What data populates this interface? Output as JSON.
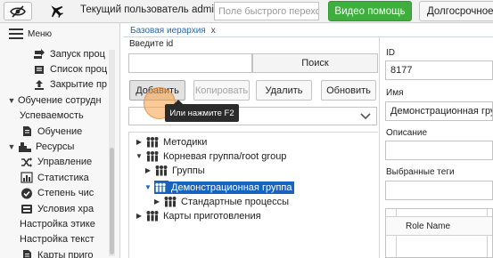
{
  "topbar": {
    "current_user": "Текущий пользователь admin",
    "quick_search_placeholder": "Поле быстрого перехо,",
    "video_help": "Видео помощь",
    "long_button": "Долгосрочное"
  },
  "sidebar": {
    "menu_label": "Меню",
    "items": [
      {
        "label": "Запуск проц",
        "icon": "run-process-icon",
        "indent": 2
      },
      {
        "label": "Список проц",
        "icon": "process-list-icon",
        "indent": 2
      },
      {
        "label": "Закрытие пр",
        "icon": "closing-icon",
        "indent": 2
      },
      {
        "label": "Обучение сотрудн",
        "icon": "",
        "indent": 0,
        "arrow": "▼"
      },
      {
        "label": "Успеваемость",
        "icon": "",
        "indent": 1
      },
      {
        "label": "Обучение",
        "icon": "document-icon",
        "indent": 1
      },
      {
        "label": "Ресурсы",
        "icon": "resources-icon",
        "indent": 0,
        "arrow": "▼"
      },
      {
        "label": "Управление",
        "icon": "shuffle-icon",
        "indent": 1
      },
      {
        "label": "Статистика",
        "icon": "bar-chart-icon",
        "indent": 1
      },
      {
        "label": "Степень чис",
        "icon": "check-circle-icon",
        "indent": 1
      },
      {
        "label": "Условия хра",
        "icon": "storage-icon",
        "indent": 1
      },
      {
        "label": "Настройка этике",
        "icon": "",
        "indent": 1
      },
      {
        "label": "Настройка текст",
        "icon": "",
        "indent": 1
      },
      {
        "label": "Карты приго",
        "icon": "document-icon",
        "indent": 1
      }
    ]
  },
  "tab": {
    "label": "Базовая иерархия",
    "close": "x"
  },
  "form": {
    "enter_id_label": "Введите id",
    "find_button": "Поиск",
    "add_button": "Добавить",
    "copy_button": "Копировать",
    "delete_button": "Удалить",
    "update_button": "Обновить",
    "tooltip": "Или нажмите F2"
  },
  "tree": {
    "nodes": [
      {
        "label": "Методики",
        "level": 0,
        "arrow": "▶",
        "selected": false
      },
      {
        "label": "Корневая группа/root group",
        "level": 0,
        "arrow": "▼",
        "selected": false
      },
      {
        "label": "Группы",
        "level": 1,
        "arrow": "▶",
        "selected": false
      },
      {
        "label": "Демонстрационная группа",
        "level": 1,
        "arrow": "▼",
        "selected": true
      },
      {
        "label": "Стандартные процессы",
        "level": 2,
        "arrow": "▶",
        "selected": false
      },
      {
        "label": "Карты приготовления",
        "level": 0,
        "arrow": "▶",
        "selected": false
      }
    ]
  },
  "details": {
    "id_label": "ID",
    "id_value": "8177",
    "name_label": "Имя",
    "name_value": "Демонстрационная груп",
    "description_label": "Описание",
    "description_value": "",
    "tags_label": "Выбранные теги",
    "tags_value": "",
    "role_name_header": "Role Name"
  },
  "colors": {
    "accent": "#1565c0",
    "video_help_bg": "#3fae3f",
    "tab_text": "#2a6aa8"
  }
}
